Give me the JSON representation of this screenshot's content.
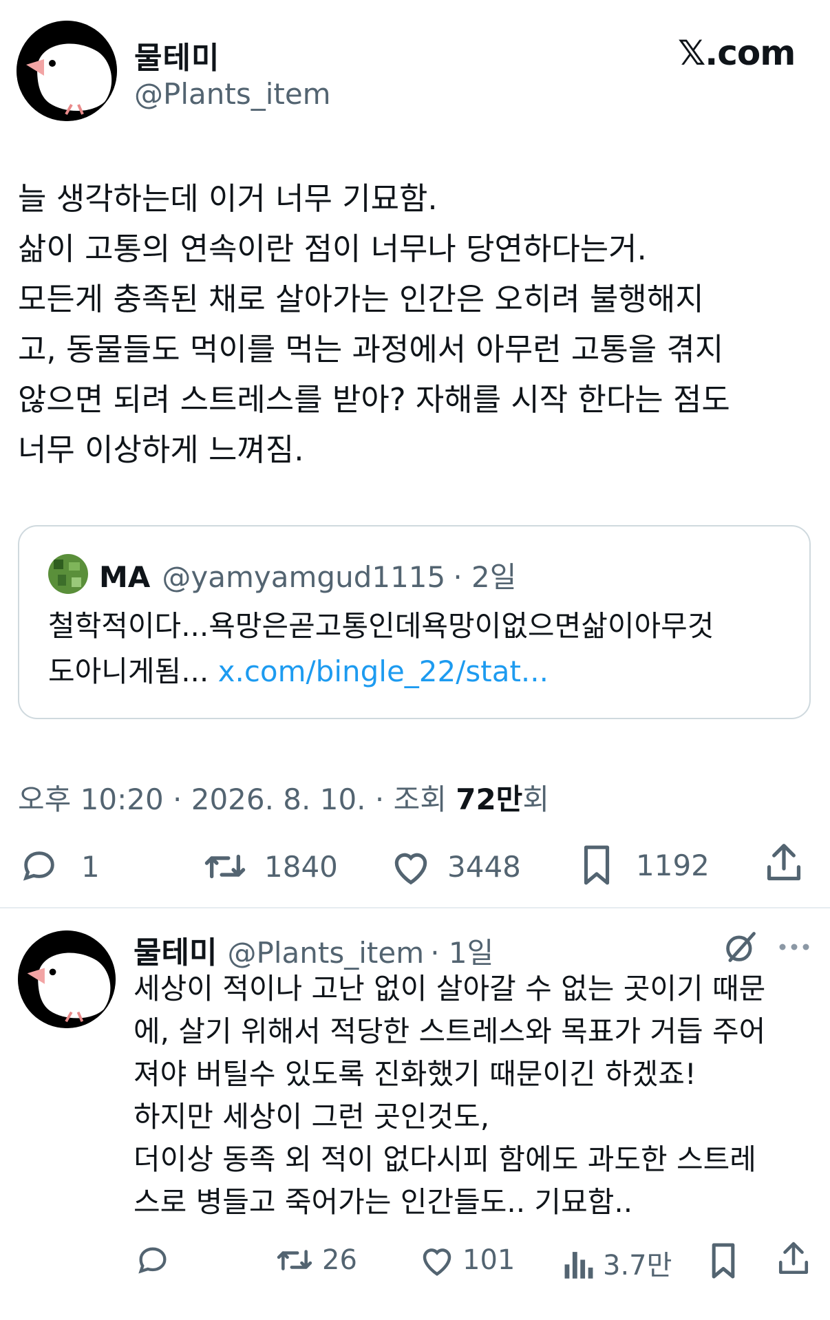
{
  "header": {
    "name": "물테미",
    "handle": "@Plants_item",
    "brand": "𝕏.com"
  },
  "tweet": {
    "text": "늘 생각하는데 이거 너무 기묘함.\n삶이 고통의 연속이란 점이 너무나 당연하다는거.\n모든게 충족된 채로 살아가는 인간은 오히려 불행해지\n고, 동물들도 먹이를 먹는 과정에서 아무런 고통을 겪지\n않으면 되려 스트레스를 받아? 자해를 시작 한다는 점도\n너무 이상하게 느껴짐."
  },
  "quote": {
    "name": "MA",
    "handle": "@yamyamgud1115",
    "time": "· 2일",
    "text": "철학적이다...욕망은곧고통인데욕망이없으면삶이아무것\n도아니게됨... ",
    "link": "x.com/bingle_22/stat..."
  },
  "timestamp": {
    "prefix": "오후 10:20 · 2026. 8. 10. · 조회 ",
    "views": "72만",
    "suffix": "회"
  },
  "actions": {
    "replies": "1",
    "retweets": "1840",
    "likes": "3448",
    "bookmarks": "1192"
  },
  "reply": {
    "name": "물테미",
    "handle": "@Plants_item",
    "time": "· 1일",
    "text": "세상이 적이나 고난 없이 살아갈 수 없는 곳이기 때문\n에, 살기 위해서 적당한 스트레스와 목표가 거듭 주어\n져야 버틸수 있도록 진화했기 때문이긴 하겠죠!\n하지만 세상이 그런 곳인것도,\n더이상 동족 외 적이 없다시피 함에도 과도한 스트레\n스로 병들고 죽어가는 인간들도.. 기묘함..",
    "actions": {
      "retweets": "26",
      "likes": "101",
      "views": "3.7만"
    }
  },
  "icons": {
    "reply": "speech-bubble-icon",
    "retweet": "retweet-icon",
    "like": "heart-icon",
    "bookmark": "bookmark-icon",
    "share": "share-icon",
    "views": "bar-chart-icon",
    "grok": "grok-slash-icon",
    "more": "more-dots-icon"
  },
  "colors": {
    "text": "#0f1419",
    "muted": "#536471",
    "link": "#1d9bf0",
    "border": "#cfd9de"
  }
}
